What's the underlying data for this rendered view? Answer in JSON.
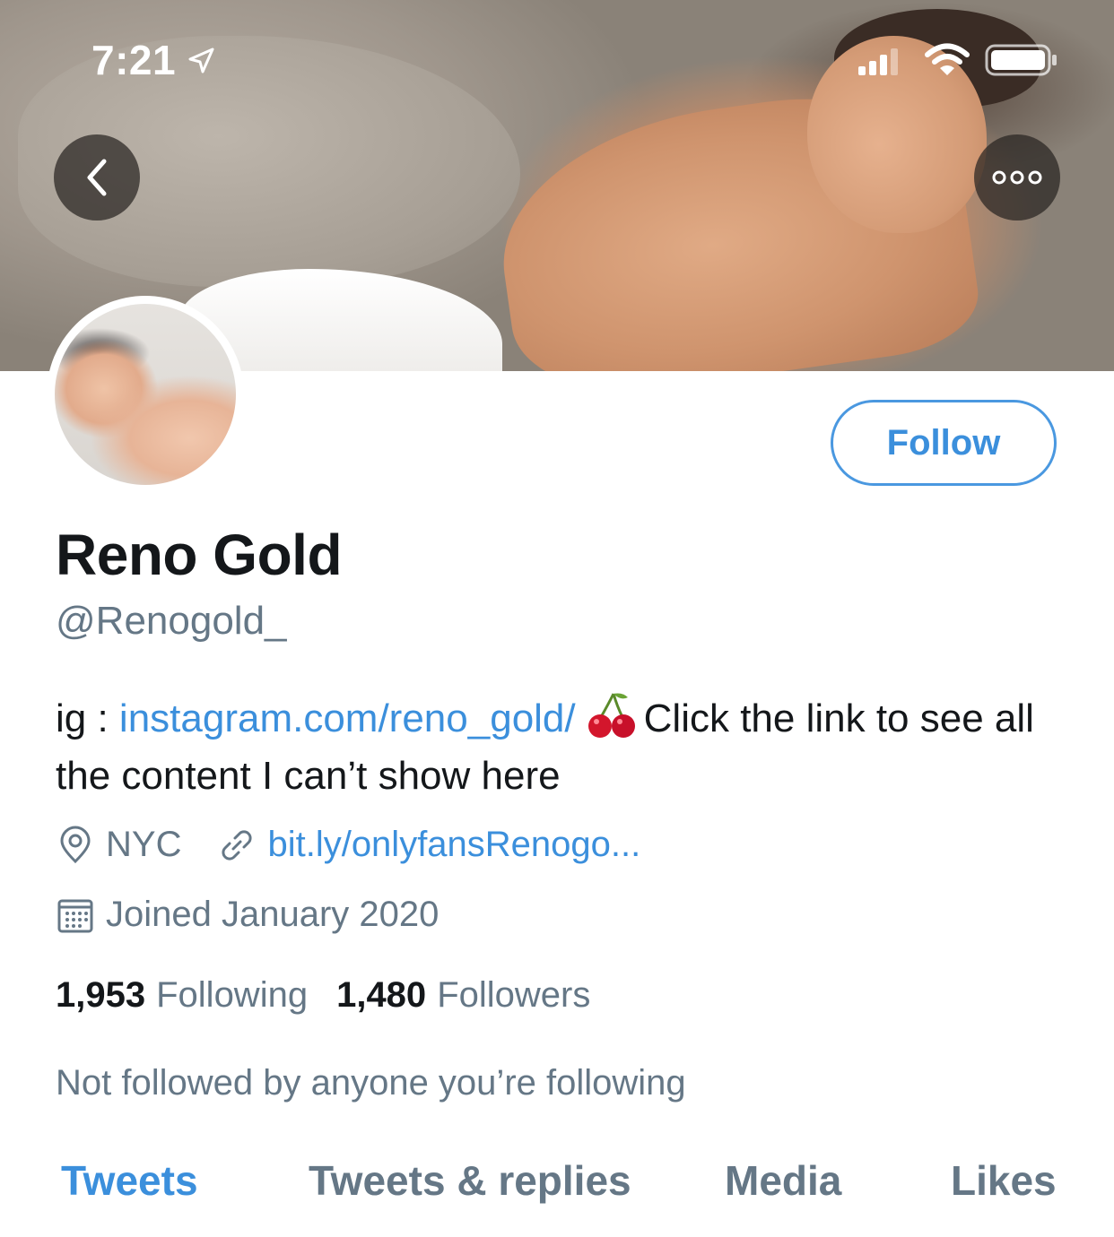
{
  "status_bar": {
    "time": "7:21",
    "icons": [
      "location-arrow-icon",
      "signal-icon",
      "wifi-icon",
      "battery-icon"
    ]
  },
  "header": {
    "back_icon": "chevron-left-icon",
    "more_icon": "more-horizontal-icon"
  },
  "profile": {
    "follow_label": "Follow",
    "display_name": "Reno Gold",
    "handle": "@Renogold_",
    "bio_prefix": "ig : ",
    "bio_link": "instagram.com/reno_gold/",
    "bio_emoji": "cherry-icon",
    "bio_suffix": "Click the link to see all the content I can’t show here",
    "location": "NYC",
    "website": "bit.ly/onlyfansRenogo...",
    "joined": "Joined January 2020",
    "following_count": "1,953",
    "following_label": "Following",
    "followers_count": "1,480",
    "followers_label": "Followers",
    "followed_by": "Not followed by anyone you’re following"
  },
  "tabs": [
    {
      "label": "Tweets",
      "active": true
    },
    {
      "label": "Tweets & replies",
      "active": false
    },
    {
      "label": "Media",
      "active": false
    },
    {
      "label": "Likes",
      "active": false
    }
  ],
  "colors": {
    "accent": "#3b8fdc",
    "text": "#14171a",
    "secondary": "#657786"
  }
}
